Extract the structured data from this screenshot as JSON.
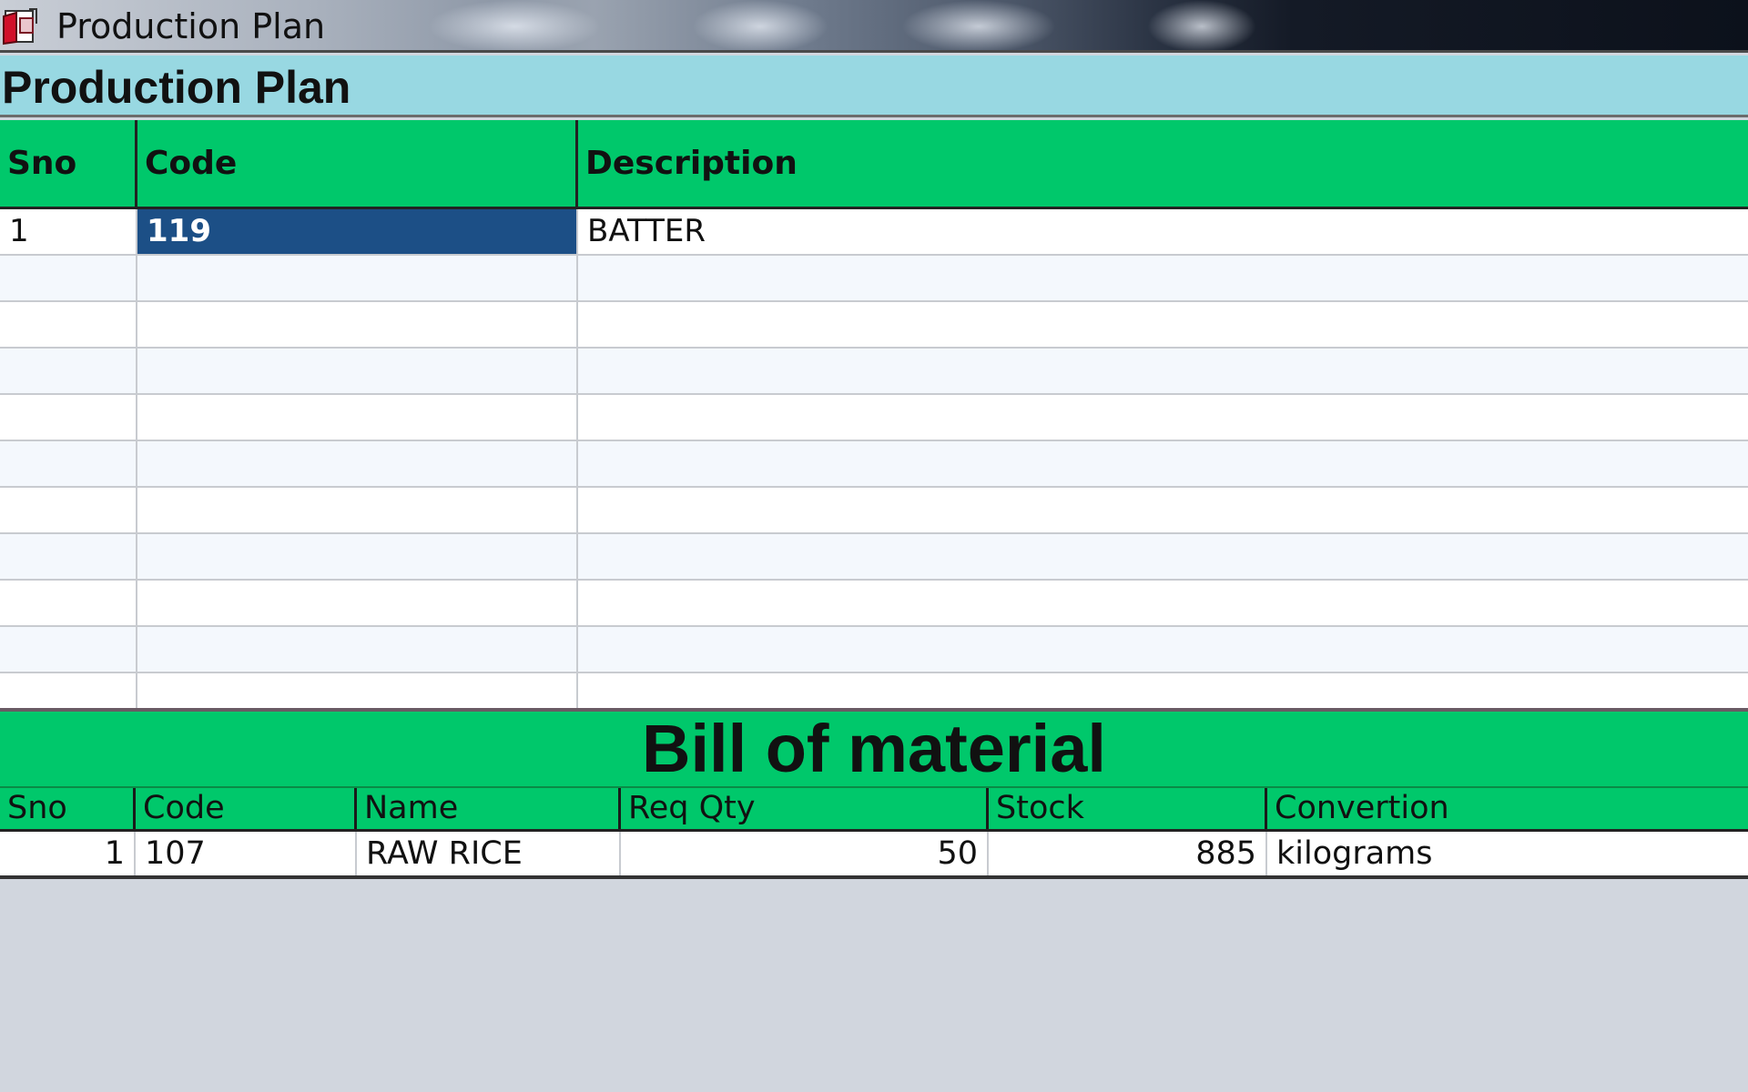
{
  "window": {
    "title": "Production Plan",
    "icon": "app-document-icon"
  },
  "header": {
    "heading": "Production Plan"
  },
  "plan_grid": {
    "columns": [
      "Sno",
      "Code",
      "Description"
    ],
    "rows": [
      {
        "sno": "1",
        "code": "119",
        "description": "BATTER",
        "selected_cell": "code"
      },
      {
        "sno": "",
        "code": "",
        "description": ""
      },
      {
        "sno": "",
        "code": "",
        "description": ""
      },
      {
        "sno": "",
        "code": "",
        "description": ""
      },
      {
        "sno": "",
        "code": "",
        "description": ""
      },
      {
        "sno": "",
        "code": "",
        "description": ""
      },
      {
        "sno": "",
        "code": "",
        "description": ""
      },
      {
        "sno": "",
        "code": "",
        "description": ""
      },
      {
        "sno": "",
        "code": "",
        "description": ""
      },
      {
        "sno": "",
        "code": "",
        "description": ""
      },
      {
        "sno": "",
        "code": "",
        "description": ""
      }
    ]
  },
  "bom": {
    "title": "Bill of material",
    "columns": [
      "Sno",
      "Code",
      "Name",
      "Req Qty",
      "Stock",
      "Convertion"
    ],
    "rows": [
      {
        "sno": "1",
        "code": "107",
        "name": "RAW RICE",
        "req_qty": "50",
        "stock": "885",
        "convertion": "kilograms"
      }
    ]
  },
  "colors": {
    "grid_header": "#00c86b",
    "header_band": "#98d8e2",
    "selection": "#1c4f86",
    "background": "#d1d6de"
  }
}
